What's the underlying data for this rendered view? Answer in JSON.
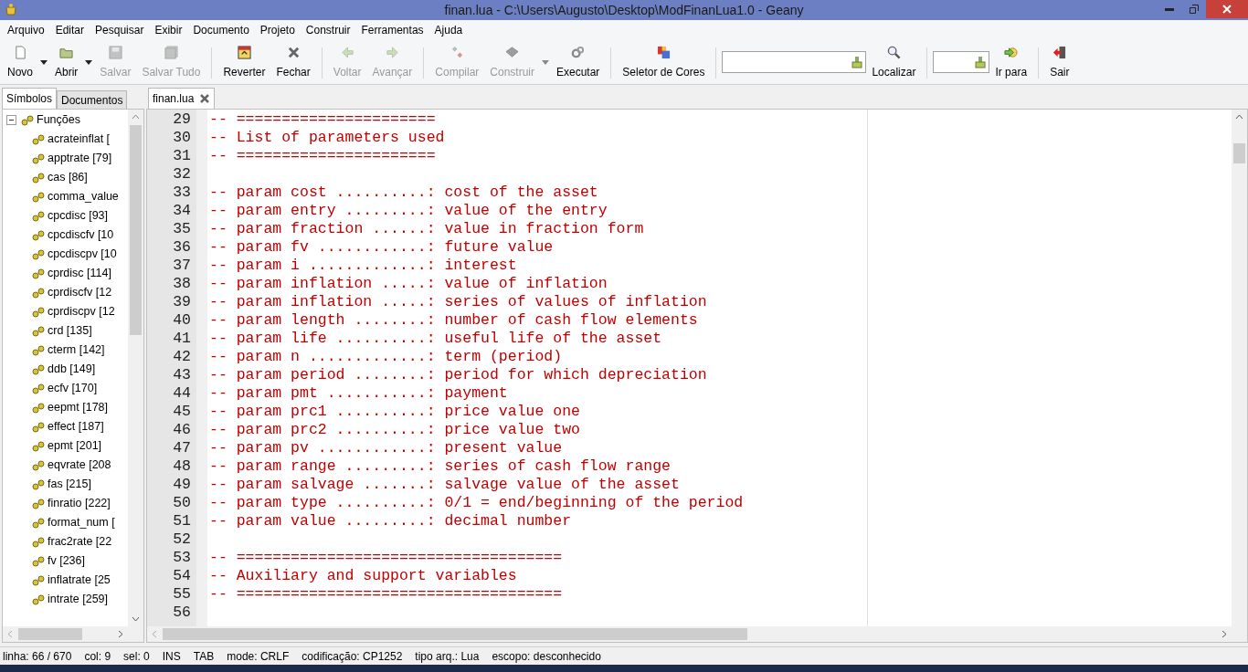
{
  "window": {
    "title": "finan.lua - C:\\Users\\Augusto\\Desktop\\ModFinanLua1.0 - Geany"
  },
  "menu": [
    "Arquivo",
    "Editar",
    "Pesquisar",
    "Exibir",
    "Documento",
    "Projeto",
    "Construir",
    "Ferramentas",
    "Ajuda"
  ],
  "toolbar": [
    {
      "kind": "button",
      "label": "Novo",
      "disabled": false,
      "has_menu": true
    },
    {
      "kind": "button",
      "label": "Abrir",
      "disabled": false,
      "has_menu": true
    },
    {
      "kind": "button",
      "label": "Salvar",
      "disabled": true,
      "has_menu": false
    },
    {
      "kind": "button",
      "label": "Salvar Tudo",
      "disabled": true,
      "has_menu": false
    },
    {
      "kind": "separator"
    },
    {
      "kind": "button",
      "label": "Reverter",
      "disabled": false,
      "has_menu": false
    },
    {
      "kind": "button",
      "label": "Fechar",
      "disabled": false,
      "has_menu": false
    },
    {
      "kind": "separator"
    },
    {
      "kind": "button",
      "label": "Voltar",
      "disabled": true,
      "has_menu": false
    },
    {
      "kind": "button",
      "label": "Avançar",
      "disabled": true,
      "has_menu": false
    },
    {
      "kind": "separator"
    },
    {
      "kind": "button",
      "label": "Compilar",
      "disabled": true,
      "has_menu": false
    },
    {
      "kind": "button",
      "label": "Construir",
      "disabled": true,
      "has_menu": true
    },
    {
      "kind": "button",
      "label": "Executar",
      "disabled": false,
      "has_menu": false
    },
    {
      "kind": "separator"
    },
    {
      "kind": "button",
      "label": "Seletor de Cores",
      "disabled": false,
      "has_menu": false
    },
    {
      "kind": "separator"
    },
    {
      "kind": "search_field"
    },
    {
      "kind": "button",
      "label": "Localizar",
      "disabled": false,
      "has_menu": false
    },
    {
      "kind": "separator"
    },
    {
      "kind": "line_field"
    },
    {
      "kind": "button",
      "label": "Ir para",
      "disabled": false,
      "has_menu": false
    },
    {
      "kind": "separator"
    },
    {
      "kind": "button",
      "label": "Sair",
      "disabled": false,
      "has_menu": false
    }
  ],
  "sidebar": {
    "tabs": [
      {
        "label": "Símbolos",
        "selected": true
      },
      {
        "label": "Documentos",
        "selected": false
      }
    ],
    "tree": [
      {
        "label": "Funções",
        "expanded": true,
        "children": [
          {
            "label": "acrateinflat ["
          },
          {
            "label": "apptrate [79]"
          },
          {
            "label": "cas [86]"
          },
          {
            "label": "comma_value"
          },
          {
            "label": "cpcdisc [93]"
          },
          {
            "label": "cpcdiscfv [10"
          },
          {
            "label": "cpcdiscpv [10"
          },
          {
            "label": "cprdisc [114]"
          },
          {
            "label": "cprdiscfv [12"
          },
          {
            "label": "cprdiscpv [12"
          },
          {
            "label": "crd [135]"
          },
          {
            "label": "cterm [142]"
          },
          {
            "label": "ddb [149]"
          },
          {
            "label": "ecfv [170]"
          },
          {
            "label": "eepmt [178]"
          },
          {
            "label": "effect [187]"
          },
          {
            "label": "epmt [201]"
          },
          {
            "label": "eqvrate [208"
          },
          {
            "label": "fas [215]"
          },
          {
            "label": "finratio [222]"
          },
          {
            "label": "format_num ["
          },
          {
            "label": "frac2rate [22"
          },
          {
            "label": "fv [236]"
          },
          {
            "label": "inflatrate [25"
          },
          {
            "label": "intrate [259]"
          }
        ]
      }
    ]
  },
  "editor": {
    "tabs": [
      {
        "label": "finan.lua",
        "selected": true
      }
    ],
    "lines": [
      {
        "number": "29",
        "text": "-- ======================"
      },
      {
        "number": "30",
        "text": "-- List of parameters used"
      },
      {
        "number": "31",
        "text": "-- ======================"
      },
      {
        "number": "32"
      },
      {
        "number": "33",
        "text": "-- param cost ..........: cost of the asset"
      },
      {
        "number": "34",
        "text": "-- param entry .........: value of the entry"
      },
      {
        "number": "35",
        "text": "-- param fraction ......: value in fraction form"
      },
      {
        "number": "36",
        "text": "-- param fv ............: future value"
      },
      {
        "number": "37",
        "text": "-- param i .............: interest"
      },
      {
        "number": "38",
        "text": "-- param inflation .....: value of inflation"
      },
      {
        "number": "39",
        "text": "-- param inflation .....: series of values of inflation"
      },
      {
        "number": "40",
        "text": "-- param length ........: number of cash flow elements"
      },
      {
        "number": "41",
        "text": "-- param life ..........: useful life of the asset"
      },
      {
        "number": "42",
        "text": "-- param n .............: term (period)"
      },
      {
        "number": "43",
        "text": "-- param period ........: period for which depreciation"
      },
      {
        "number": "44",
        "text": "-- param pmt ...........: payment"
      },
      {
        "number": "45",
        "text": "-- param prc1 ..........: price value one"
      },
      {
        "number": "46",
        "text": "-- param prc2 ..........: price value two"
      },
      {
        "number": "47",
        "text": "-- param pv ............: present value"
      },
      {
        "number": "48",
        "text": "-- param range .........: series of cash flow range"
      },
      {
        "number": "49",
        "text": "-- param salvage .......: salvage value of the asset"
      },
      {
        "number": "50",
        "text": "-- param type ..........: 0/1 = end/beginning of the period"
      },
      {
        "number": "51",
        "text": "-- param value .........: decimal number"
      },
      {
        "number": "52"
      },
      {
        "number": "53",
        "text": "-- ===================================="
      },
      {
        "number": "54",
        "text": "-- Auxiliary and support variables"
      },
      {
        "number": "55",
        "text": "-- ===================================="
      },
      {
        "number": "56"
      }
    ]
  },
  "status_bar": [
    "linha: 66 / 670",
    "col: 9",
    "sel: 0",
    "INS",
    "TAB",
    "mode: CRLF",
    "codificação: CP1252",
    "tipo arq.: Lua",
    "escopo: desconhecido"
  ]
}
